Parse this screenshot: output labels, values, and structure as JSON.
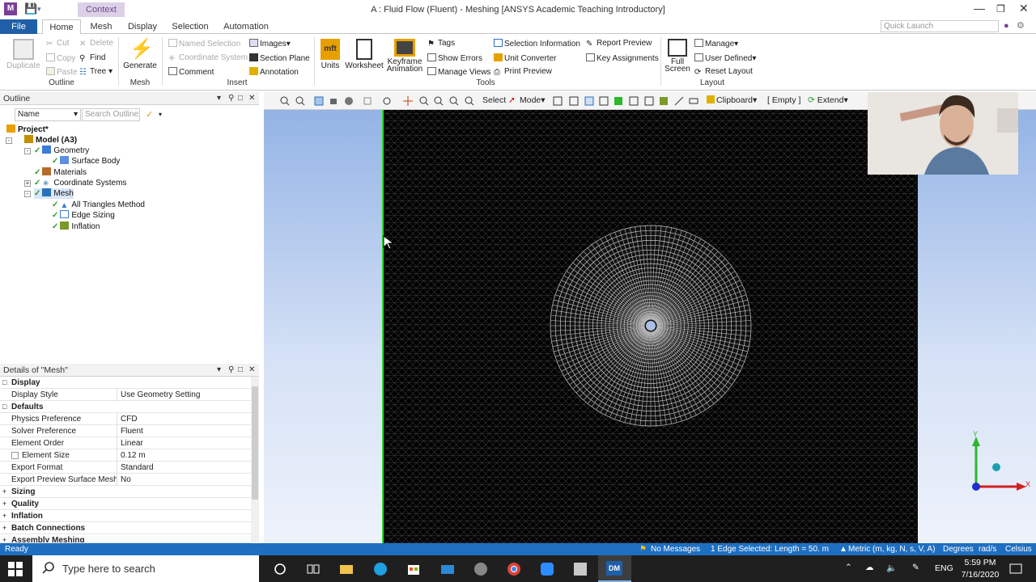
{
  "window": {
    "title": "A : Fluid Flow (Fluent) - Meshing [ANSYS Academic Teaching Introductory]",
    "context_tab": "Context",
    "app_icon": "M"
  },
  "tabs": [
    {
      "label": "File"
    },
    {
      "label": "Home"
    },
    {
      "label": "Mesh"
    },
    {
      "label": "Display"
    },
    {
      "label": "Selection"
    },
    {
      "label": "Automation"
    }
  ],
  "quick_launch": {
    "placeholder": "Quick Launch"
  },
  "ribbon": {
    "outline": {
      "duplicate": "Duplicate",
      "cut": "Cut",
      "copy": "Copy",
      "paste": "Paste",
      "delete": "Delete",
      "find": "Find",
      "tree": "Tree",
      "group": "Outline"
    },
    "mesh": {
      "generate": "Generate",
      "group": "Mesh"
    },
    "insert": {
      "named_selection": "Named Selection",
      "coordinate_system": "Coordinate System",
      "comment": "Comment",
      "images": "Images",
      "section_plane": "Section Plane",
      "annotation": "Annotation",
      "group": "Insert"
    },
    "tools": {
      "units": "Units",
      "worksheet": "Worksheet",
      "keyframe_1": "Keyframe",
      "keyframe_2": "Animation",
      "tags": "Tags",
      "show_errors": "Show Errors",
      "manage_views": "Manage Views",
      "selection_information": "Selection Information",
      "unit_converter": "Unit Converter",
      "print_preview": "Print Preview",
      "report_preview": "Report Preview",
      "key_assignments": "Key Assignments",
      "group": "Tools"
    },
    "layout": {
      "full_1": "Full",
      "full_2": "Screen",
      "manage": "Manage",
      "user_defined": "User Defined",
      "reset_layout": "Reset Layout",
      "group": "Layout"
    }
  },
  "outline": {
    "title": "Outline",
    "name_filter": "Name",
    "search_placeholder": "Search Outline",
    "tree": {
      "project": "Project*",
      "model": "Model (A3)",
      "geometry": "Geometry",
      "surface_body": "Surface Body",
      "materials": "Materials",
      "coordinate_systems": "Coordinate Systems",
      "mesh": "Mesh",
      "all_triangles": "All Triangles Method",
      "edge_sizing": "Edge Sizing",
      "inflation": "Inflation"
    }
  },
  "details": {
    "title": "Details of \"Mesh\"",
    "sections": {
      "display": "Display",
      "defaults": "Defaults",
      "sizing": "Sizing",
      "quality": "Quality",
      "inflation": "Inflation",
      "batch_connections": "Batch Connections",
      "assembly_meshing": "Assembly Meshing"
    },
    "rows": {
      "display_style": {
        "k": "Display Style",
        "v": "Use Geometry Setting"
      },
      "physics_preference": {
        "k": "Physics Preference",
        "v": "CFD"
      },
      "solver_preference": {
        "k": "Solver Preference",
        "v": "Fluent"
      },
      "element_order": {
        "k": "Element Order",
        "v": "Linear"
      },
      "element_size": {
        "k": "Element Size",
        "v": "0.12 m"
      },
      "export_format": {
        "k": "Export Format",
        "v": "Standard"
      },
      "export_preview": {
        "k": "Export Preview Surface Mesh",
        "v": "No"
      }
    }
  },
  "viewport_toolbar": {
    "select": "Select",
    "mode": "Mode",
    "clipboard": "Clipboard",
    "empty": "[ Empty ]",
    "extend": "Extend"
  },
  "triad": {
    "y": "Y",
    "x": "X"
  },
  "statusbar": {
    "ready": "Ready",
    "messages": "No Messages",
    "selection": "1 Edge Selected: Length = 50. m",
    "units": "Metric (m, kg, N, s, V, A)",
    "degrees": "Degrees",
    "rads": "rad/s",
    "temp": "Celsius"
  },
  "taskbar": {
    "search_placeholder": "Type here to search",
    "lang": "ENG",
    "time": "5:59 PM",
    "date": "7/16/2020"
  },
  "colors": {
    "accent": "#1f5fa8",
    "status": "#1f6fc1",
    "mesh_bg": "#000000",
    "mesh_border": "#2bd82b"
  }
}
